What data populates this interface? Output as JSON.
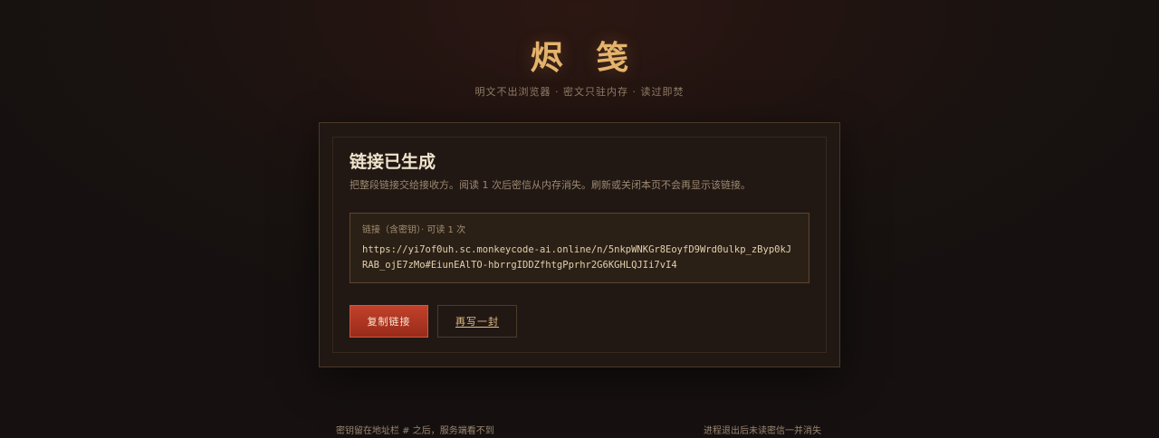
{
  "header": {
    "title": "烬 笺",
    "tagline": "明文不出浏览器 · 密文只驻内存 · 读过即焚"
  },
  "card": {
    "title": "链接已生成",
    "description": "把整段链接交给接收方。阅读 1 次后密信从内存消失。刷新或关闭本页不会再显示该链接。",
    "link_label": "链接（含密钥）· 可读 1 次",
    "link_url": "https://yi7of0uh.sc.monkeycode-ai.online/n/5nkpWNKGr8EoyfD9Wrd0ulkp_zByp0kJRAB_ojE7zMo#EiunEAlTO-hbrrgIDDZfhtgPprhr2G6KGHLQJIi7vI4",
    "copy_button": "复制链接",
    "rewrite_button": "再写一封"
  },
  "footer": {
    "left": "密钥留在地址栏 # 之后，服务端看不到",
    "right": "进程退出后未读密信一并消失"
  },
  "colors": {
    "accent": "#e4b36c",
    "button_primary": "#b03a24",
    "background": "#181210"
  }
}
